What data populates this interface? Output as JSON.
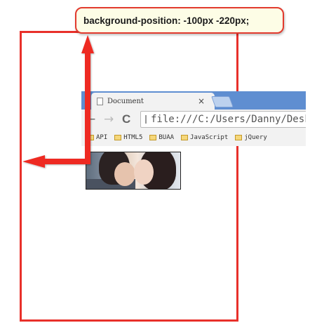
{
  "callout": {
    "text": "background-position: -100px -220px;"
  },
  "browser": {
    "tab_title": "Document",
    "tab_close": "×",
    "nav": {
      "back": "←",
      "forward": "→",
      "reload": "C"
    },
    "address": "file:///C:/Users/Danny/Desktop",
    "bookmarks": [
      "API",
      "HTML5",
      "BUAA",
      "JavaScript",
      "jQuery"
    ]
  },
  "colors": {
    "annotation_red": "#e8302a",
    "tab_blue": "#5f8ed1",
    "callout_bg": "#fdfde6"
  }
}
